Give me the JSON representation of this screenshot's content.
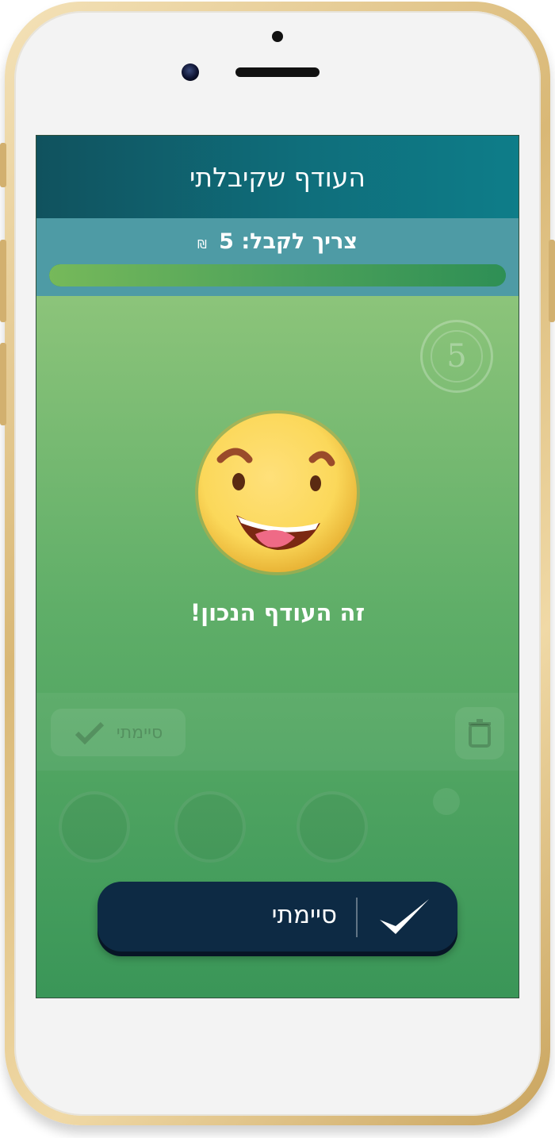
{
  "header": {
    "title": "העודף שקיבלתי"
  },
  "status": {
    "need_label": "צריך לקבל:",
    "amount": "5",
    "currency": "₪",
    "progress": 1.0
  },
  "coin": {
    "value": "5"
  },
  "feedback": {
    "message": "זה העודף הנכון!",
    "emoji": "happy-face-icon"
  },
  "background_controls": {
    "done_label": "סיימתי"
  },
  "done_button": {
    "label": "סיימתי"
  },
  "colors": {
    "header": "#0f6e7b",
    "subheader": "#4e9ba5",
    "button": "#0d2a44",
    "progress": "#2e8f55"
  }
}
